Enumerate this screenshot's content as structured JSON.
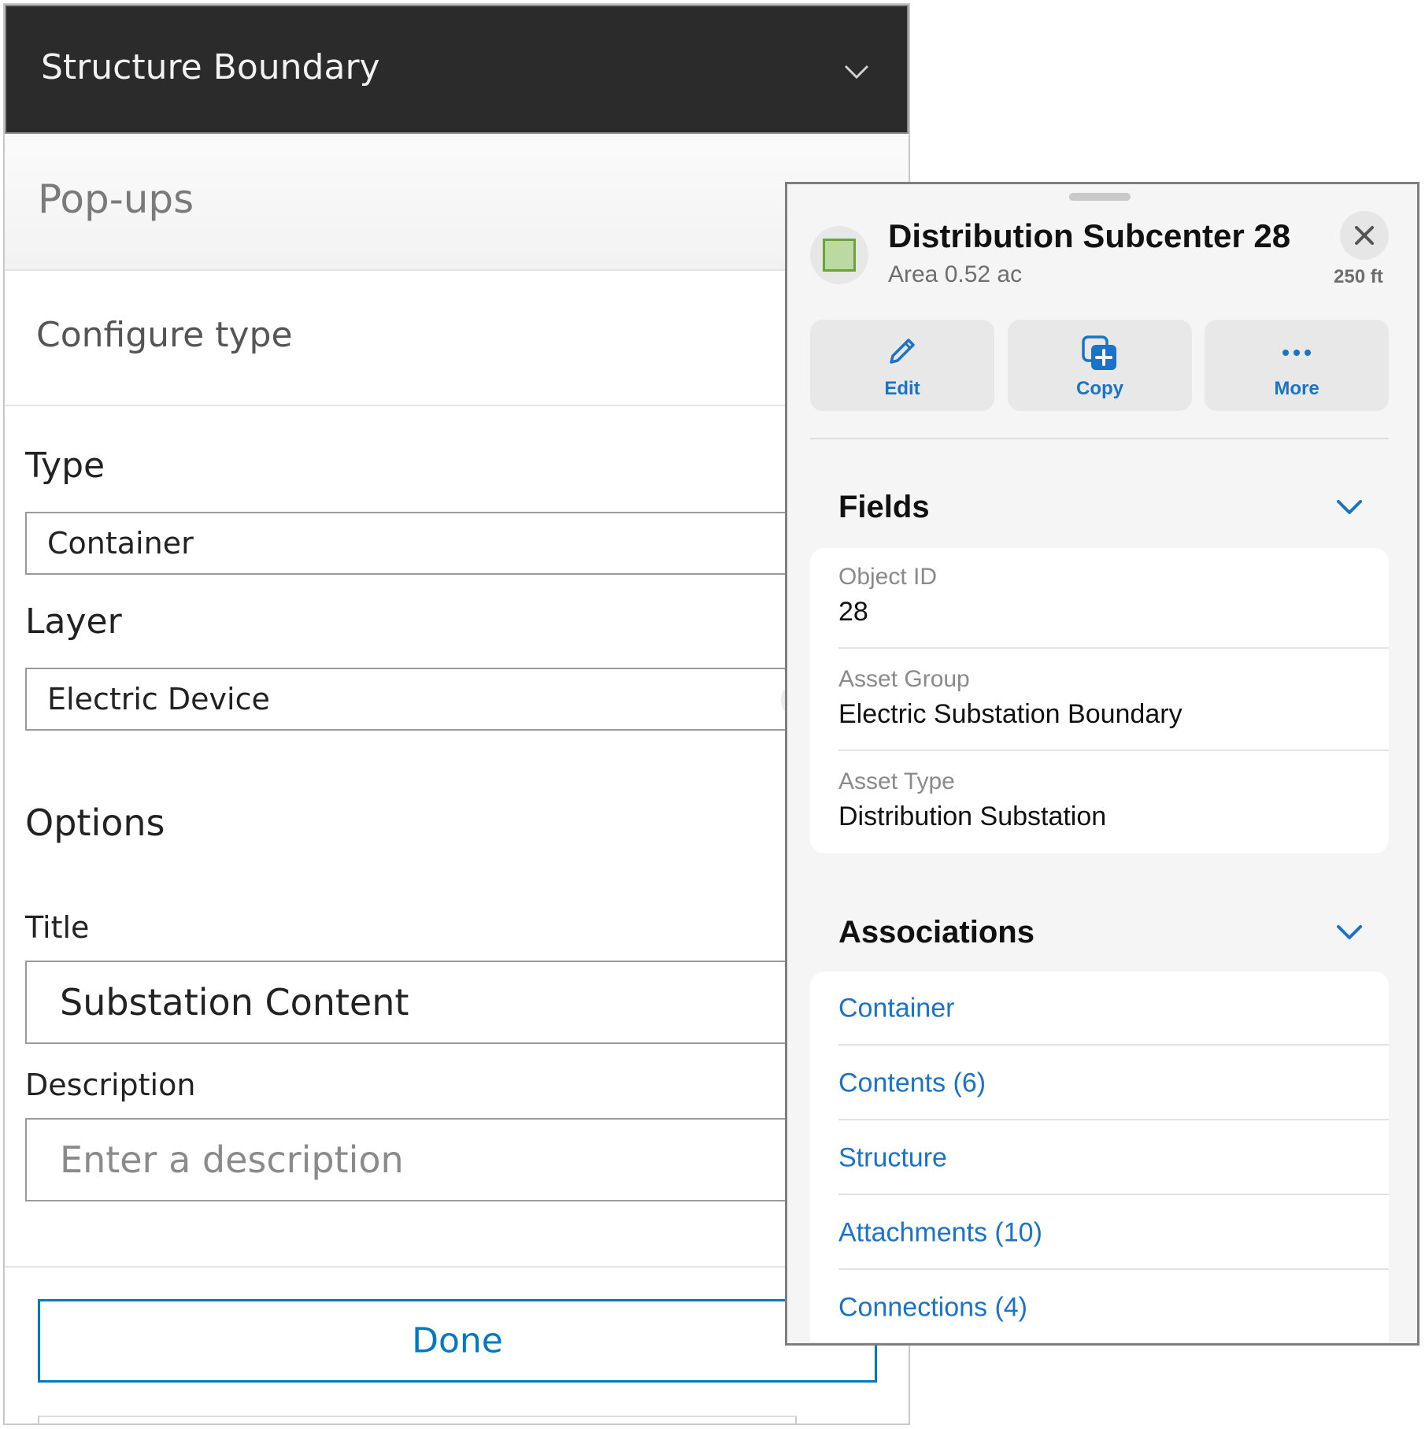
{
  "config_panel": {
    "header_title": "Structure Boundary",
    "popups_label": "Pop-ups",
    "configure_label": "Configure type",
    "type": {
      "label": "Type",
      "value": "Container"
    },
    "layer": {
      "label": "Layer",
      "value": "Electric Device"
    },
    "options_label": "Options",
    "title": {
      "label": "Title",
      "value": "Substation Content"
    },
    "description": {
      "label": "Description",
      "placeholder": "Enter a description"
    },
    "done_label": "Done",
    "accent_color": "#0079c1"
  },
  "popup": {
    "title": "Distribution Subcenter 28",
    "subtitle": "Area 0.52 ac",
    "scale": "250 ft",
    "actions": [
      {
        "label": "Edit",
        "icon": "pencil-icon"
      },
      {
        "label": "Copy",
        "icon": "copy-plus-icon"
      },
      {
        "label": "More",
        "icon": "ellipsis-icon"
      }
    ],
    "fields_section": {
      "title": "Fields",
      "rows": [
        {
          "label": "Object ID",
          "value": "28"
        },
        {
          "label": "Asset Group",
          "value": "Electric Substation Boundary"
        },
        {
          "label": "Asset Type",
          "value": "Distribution Substation"
        }
      ]
    },
    "associations_section": {
      "title": "Associations",
      "items": [
        "Container",
        "Contents (6)",
        "Structure",
        "Attachments (10)",
        "Connections (4)"
      ]
    },
    "link_color": "#1a73c7",
    "feature_fill_color": "#bcd9a2",
    "feature_stroke_color": "#6aa437"
  }
}
